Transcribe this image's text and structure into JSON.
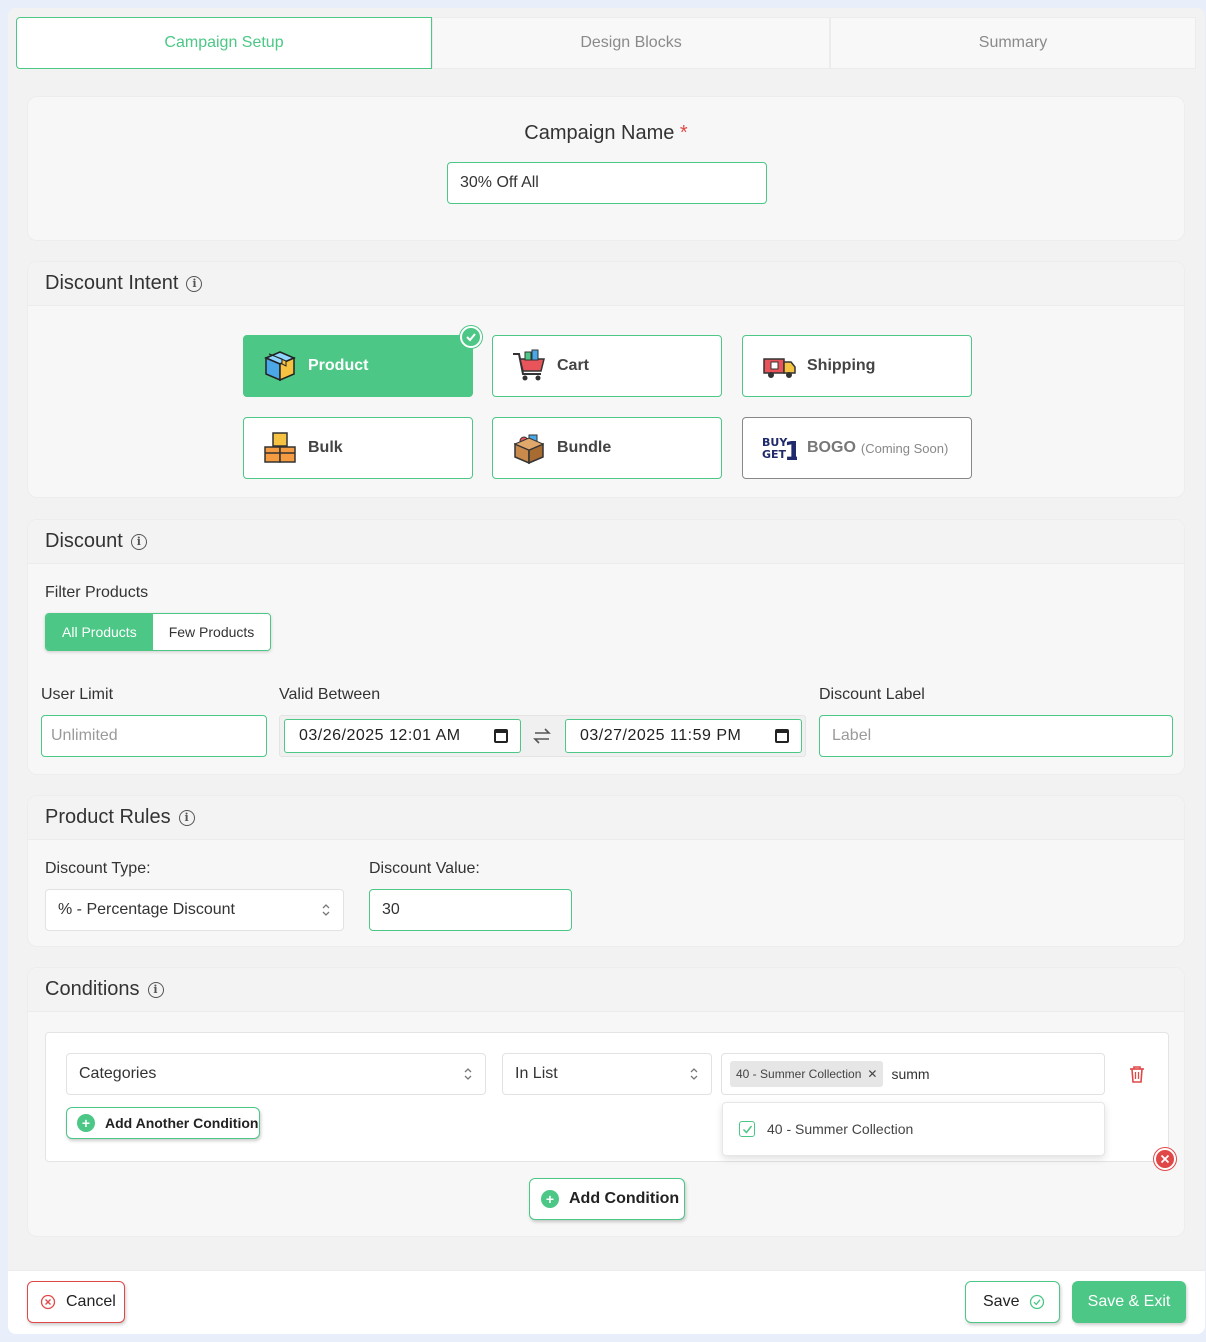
{
  "tabs": [
    {
      "label": "Campaign Setup",
      "active": true
    },
    {
      "label": "Design Blocks",
      "active": false
    },
    {
      "label": "Summary",
      "active": false
    }
  ],
  "campaign": {
    "label": "Campaign Name",
    "required_mark": "*",
    "value": "30% Off All"
  },
  "intent": {
    "title": "Discount Intent",
    "options": [
      {
        "label": "Product",
        "selected": true
      },
      {
        "label": "Cart"
      },
      {
        "label": "Shipping"
      },
      {
        "label": "Bulk"
      },
      {
        "label": "Bundle"
      },
      {
        "label": "BOGO",
        "note": "(Coming Soon)",
        "disabled": true
      }
    ]
  },
  "discount": {
    "title": "Discount",
    "filter_label": "Filter Products",
    "filter_options": [
      "All Products",
      "Few Products"
    ],
    "user_limit_label": "User Limit",
    "user_limit_placeholder": "Unlimited",
    "valid_between_label": "Valid Between",
    "start_date": "03/26/2025 12:01 AM",
    "end_date": "03/27/2025 11:59 PM",
    "label_label": "Discount Label",
    "label_placeholder": "Label"
  },
  "rules": {
    "title": "Product Rules",
    "type_label": "Discount Type:",
    "type_value": "% - Percentage Discount",
    "value_label": "Discount Value:",
    "value": "30"
  },
  "conditions": {
    "title": "Conditions",
    "field": "Categories",
    "operator": "In List",
    "tag": "40 - Summer Collection",
    "search_text": "summ",
    "dropdown_option": "40 - Summer Collection",
    "add_another": "Add Another Condition",
    "add_condition": "Add Condition"
  },
  "footer": {
    "cancel": "Cancel",
    "save": "Save",
    "save_exit": "Save & Exit"
  },
  "colors": {
    "accent": "#4cc786",
    "danger": "#e04848"
  }
}
